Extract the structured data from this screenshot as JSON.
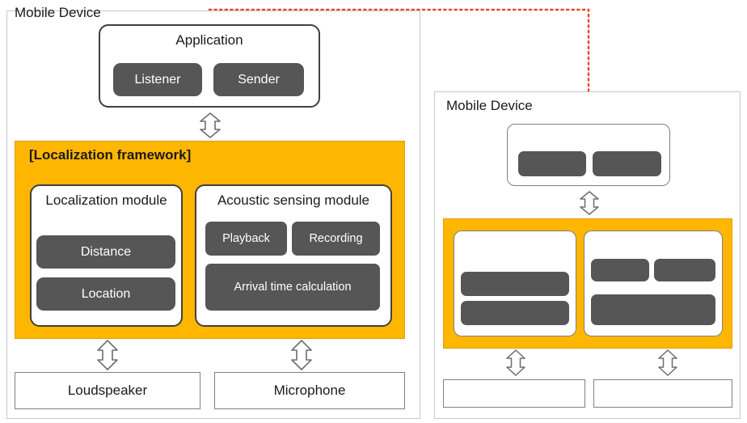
{
  "diagram": {
    "left_device": {
      "title": "Mobile Device",
      "application": {
        "title": "Application",
        "children": [
          {
            "label": "Listener"
          },
          {
            "label": "Sender"
          }
        ]
      },
      "framework": {
        "title": "[Localization framework]",
        "localization_module": {
          "title": "Localization module",
          "children": [
            {
              "label": "Distance"
            },
            {
              "label": "Location"
            }
          ]
        },
        "acoustic_module": {
          "title": "Acoustic sensing module",
          "children": [
            {
              "label": "Playback"
            },
            {
              "label": "Recording"
            },
            {
              "label": "Arrival time calculation"
            }
          ]
        }
      },
      "hardware": [
        {
          "label": "Loudspeaker"
        },
        {
          "label": "Microphone"
        }
      ]
    },
    "right_device": {
      "title": "Mobile Device",
      "application": {
        "title": "",
        "children": [
          {
            "label": ""
          },
          {
            "label": ""
          }
        ]
      },
      "framework": {
        "title": "",
        "localization_module": {
          "title": "",
          "children": [
            {
              "label": ""
            },
            {
              "label": ""
            }
          ]
        },
        "acoustic_module": {
          "title": "",
          "children": [
            {
              "label": ""
            },
            {
              "label": ""
            },
            {
              "label": ""
            }
          ]
        }
      },
      "hardware": [
        {
          "label": ""
        },
        {
          "label": ""
        }
      ]
    },
    "connector": {
      "name": "dotted-link",
      "color": "#e8472b",
      "style": "dotted",
      "from": "left-application",
      "to": "right-application"
    },
    "colors": {
      "framework_fill": "#ffb600",
      "module_fill": "#565656",
      "border": "#404040",
      "panel_border": "#c8c8c8",
      "text": "#1a1a1a"
    }
  }
}
